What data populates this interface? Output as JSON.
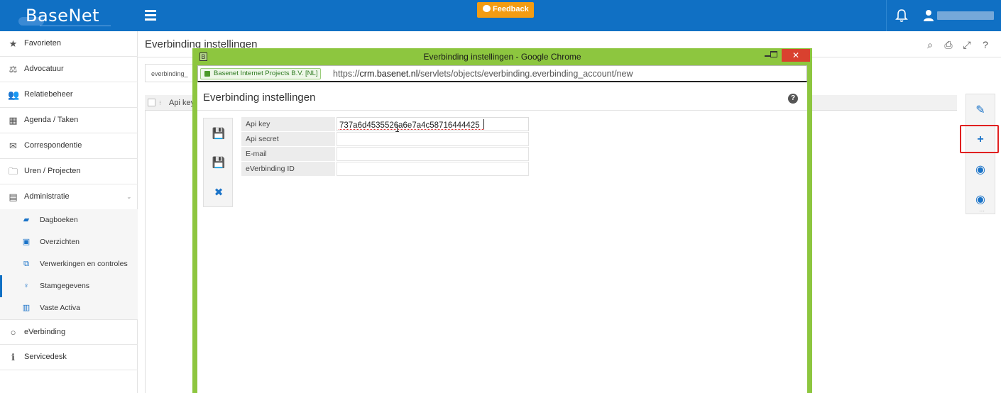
{
  "app": {
    "logo": "BaseNet",
    "feedback_label": "Feedback"
  },
  "sidebar": {
    "items": [
      {
        "label": "Favorieten",
        "icon": "star-icon"
      },
      {
        "label": "Advocatuur",
        "icon": "scale-icon"
      },
      {
        "label": "Relatiebeheer",
        "icon": "users-icon"
      },
      {
        "label": "Agenda / Taken",
        "icon": "calendar-icon"
      },
      {
        "label": "Correspondentie",
        "icon": "envelope-icon"
      },
      {
        "label": "Uren / Projecten",
        "icon": "folder-clock-icon"
      },
      {
        "label": "Administratie",
        "icon": "calculator-icon"
      }
    ],
    "subitems": [
      {
        "label": "Dagboeken",
        "icon": "book-icon"
      },
      {
        "label": "Overzichten",
        "icon": "document-icon"
      },
      {
        "label": "Verwerkingen en controles",
        "icon": "process-icon"
      },
      {
        "label": "Stamgegevens",
        "icon": "bulb-icon"
      },
      {
        "label": "Vaste Activa",
        "icon": "asset-icon"
      }
    ],
    "bottom": [
      {
        "label": "eVerbinding",
        "icon": "circle-icon"
      },
      {
        "label": "Servicedesk",
        "icon": "info-icon"
      }
    ]
  },
  "main": {
    "title": "Everbinding instellingen",
    "filter_text": "everbinding_",
    "grid_column": "Api key"
  },
  "popup": {
    "window_title": "Everbinding instellingen - Google Chrome",
    "secure_label": "Basenet Internet Projects B.V. [NL]",
    "url_prefix": "https://",
    "url_host": "crm.basenet.nl",
    "url_path": "/servlets/objects/everbinding.everbinding_account/new",
    "title": "Everbinding instellingen",
    "fields": [
      {
        "label": "Api key",
        "value": "737a6d4535526a6e7a4c58716444425"
      },
      {
        "label": "Api secret",
        "value": ""
      },
      {
        "label": "E-mail",
        "value": ""
      },
      {
        "label": "eVerbinding ID",
        "value": ""
      }
    ]
  },
  "colors": {
    "topbar": "#1070c4",
    "accent": "#1a73c8",
    "feedback": "#f39c12",
    "popup_frame": "#8dc63f",
    "highlight": "#e02020"
  }
}
